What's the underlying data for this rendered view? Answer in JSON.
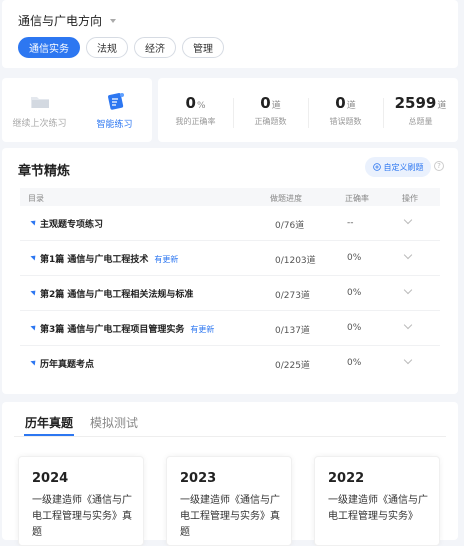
{
  "header": {
    "subject": "通信与广电方向",
    "tabs": [
      "通信实务",
      "法规",
      "经济",
      "管理"
    ]
  },
  "practice": {
    "continue_label": "继续上次练习",
    "smart_label": "智能练习"
  },
  "stats": [
    {
      "value": "0",
      "unit": "%",
      "label": "我的正确率"
    },
    {
      "value": "0",
      "unit": "道",
      "label": "正确题数"
    },
    {
      "value": "0",
      "unit": "道",
      "label": "错误题数"
    },
    {
      "value": "2599",
      "unit": "道",
      "label": "总题量"
    }
  ],
  "chapters": {
    "title": "章节精炼",
    "custom_button": "自定义刷题",
    "help": "?",
    "columns": {
      "dir": "目录",
      "progress": "做题进度",
      "rate": "正确率",
      "op": "操作"
    },
    "rows": [
      {
        "name": "主观题专项练习",
        "update": "",
        "progress": "0/76道",
        "rate": "--"
      },
      {
        "name": "第1篇 通信与广电工程技术",
        "update": "有更新",
        "progress": "0/1203道",
        "rate": "0%"
      },
      {
        "name": "第2篇 通信与广电工程相关法规与标准",
        "update": "",
        "progress": "0/273道",
        "rate": "0%"
      },
      {
        "name": "第3篇 通信与广电工程项目管理实务",
        "update": "有更新",
        "progress": "0/137道",
        "rate": "0%"
      },
      {
        "name": "历年真题考点",
        "update": "",
        "progress": "0/225道",
        "rate": "0%"
      }
    ]
  },
  "exams": {
    "tabs": [
      "历年真题",
      "模拟测试"
    ],
    "cards": [
      {
        "year": "2024",
        "title": "一级建造师《通信与广电工程管理与实务》真题"
      },
      {
        "year": "2023",
        "title": "一级建造师《通信与广电工程管理与实务》真题"
      },
      {
        "year": "2022",
        "title": "一级建造师《通信与广电工程管理与实务》"
      }
    ]
  },
  "colors": {
    "accent": "#2d77f1"
  }
}
